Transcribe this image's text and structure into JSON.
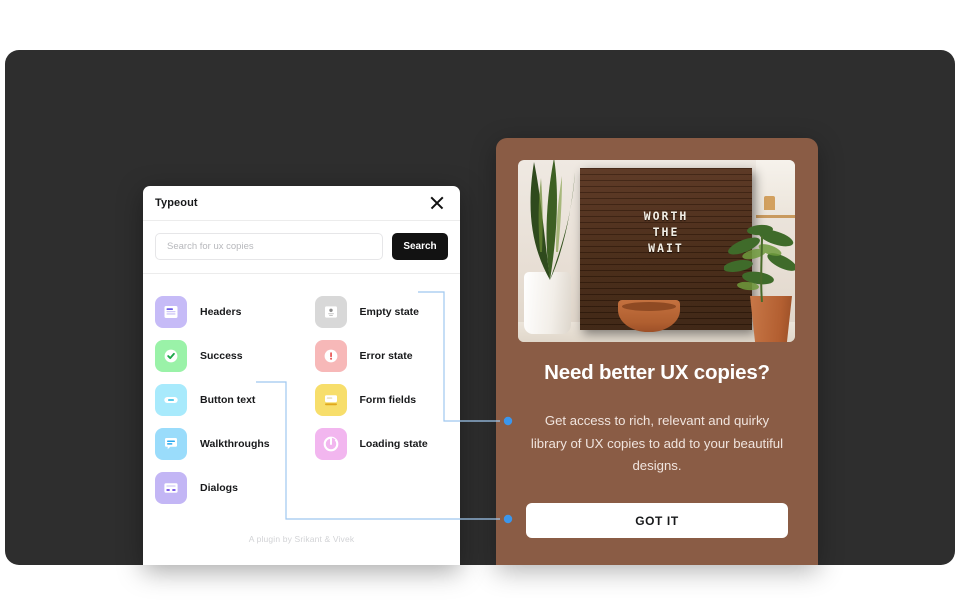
{
  "plugin": {
    "title": "Typeout",
    "close_icon": "close-icon",
    "search": {
      "placeholder": "Search for ux copies",
      "value": "",
      "button_label": "Search"
    },
    "categories_left": [
      {
        "label": "Headers",
        "icon": "headers-icon",
        "tile_color": "#c6bbf7",
        "glyph_color": "#6c5ce7"
      },
      {
        "label": "Success",
        "icon": "success-icon",
        "tile_color": "#9af2a8",
        "glyph_color": "#1fa84a"
      },
      {
        "label": "Button text",
        "icon": "button-text-icon",
        "tile_color": "#a8eafc",
        "glyph_color": "#1cb8e0"
      },
      {
        "label": "Walkthroughs",
        "icon": "walkthroughs-icon",
        "tile_color": "#9adcfb",
        "glyph_color": "#2aa9ef"
      },
      {
        "label": "Dialogs",
        "icon": "dialogs-icon",
        "tile_color": "#c3b6f5",
        "glyph_color": "#7d5ce8"
      }
    ],
    "categories_right": [
      {
        "label": "Empty state",
        "icon": "empty-state-icon",
        "tile_color": "#d8d8d8",
        "glyph_color": "#8c8c8c"
      },
      {
        "label": "Error state",
        "icon": "error-state-icon",
        "tile_color": "#f7b8b8",
        "glyph_color": "#e8504f"
      },
      {
        "label": "Form fields",
        "icon": "form-fields-icon",
        "tile_color": "#f7de6b",
        "glyph_color": "#e0a81d"
      },
      {
        "label": "Loading state",
        "icon": "loading-state-icon",
        "tile_color": "#f2b6ef",
        "glyph_color": "#d651cf"
      }
    ],
    "footer": "A plugin by Srikant & Vivek"
  },
  "promo": {
    "image": {
      "alt": "wooden letterboard with plants",
      "letterboard_lines": [
        "WORTH",
        "THE",
        "WAIT"
      ]
    },
    "title": "Need better UX copies?",
    "body": "Get access to rich, relevant and quirky library of UX copies to add to your beautiful designs.",
    "cta_label": "GOT IT",
    "card_color": "#8a5c45"
  },
  "annotations": {
    "connector_color": "#9fc8ef",
    "dot_color": "#3b96ec",
    "links": [
      {
        "from": "Empty state",
        "to": "promo-body"
      },
      {
        "from": "Button text",
        "to": "promo-cta"
      }
    ]
  },
  "canvas": {
    "backdrop_color": "#2e2e2e",
    "page_background": "#ffffff"
  }
}
